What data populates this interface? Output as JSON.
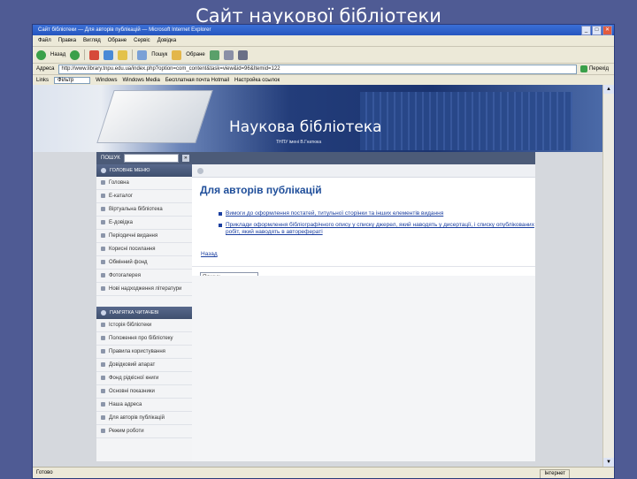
{
  "slide": {
    "title": "Сайт наукової бібліотеки"
  },
  "browser": {
    "window_title": "Сайт бібліотеки — Для авторів публікацій — Microsoft Internet Explorer",
    "window_buttons": [
      "_",
      "□",
      "✕"
    ],
    "menu": [
      "Файл",
      "Правка",
      "Вигляд",
      "Обране",
      "Сервіс",
      "Довідка"
    ],
    "toolbar": {
      "back": "Назад",
      "search": "Пошук",
      "favorites": "Обране"
    },
    "address_label": "Адреса",
    "address_value": "http://www.library.tnpu.edu.ua/index.php?option=com_content&task=view&id=96&Itemid=122",
    "go_label": "Перехід",
    "links": {
      "label": "Links",
      "search_field": "Фільтр",
      "items": [
        "Windows",
        "Windows Media",
        "Бесплатная почта Hotmail",
        "Настройка ссылок"
      ]
    },
    "status": {
      "text": "Готово",
      "zone": "Інтернет"
    },
    "colors": {
      "accent": "#1f4e9a",
      "link": "#1b3fa0"
    }
  },
  "site": {
    "banner_title": "Наукова бібліотека",
    "banner_subtitle": "ТНПУ імені В.Гнатюка",
    "search_label": "ПОШУК",
    "main_menu_title": "ГОЛОВНЕ МЕНЮ",
    "main_menu": [
      "Головна",
      "Е-каталог",
      "Віртуальна бібліотека",
      "Е-довідка",
      "Періодичні видання",
      "Корисні посилання",
      "Обмінний фонд",
      "Фотогалерея",
      "Нові надходження літератури"
    ],
    "reader_menu_title": "ПАМ'ЯТКА ЧИТАЧЕВІ",
    "reader_menu": [
      "Історія бібліотеки",
      "Положення про бібліотеку",
      "Правила користування",
      "Довідковий апарат",
      "Фонд рідкісної книги",
      "Основні показники",
      "Наша адреса",
      "Для авторів публікацій",
      "Режим роботи"
    ],
    "page_title": "Для авторів публікацій",
    "page_links": [
      "Вимоги до оформлення постатей, титульної сторінки та інших елементів видання",
      "Приклади оформлення бібліографічного опису у списку джерел, який наводять у дисертації, і списку опублікованих робіт, який наводять в авторефераті"
    ],
    "back_link": "Назад",
    "bottom_search": "Пошук"
  }
}
